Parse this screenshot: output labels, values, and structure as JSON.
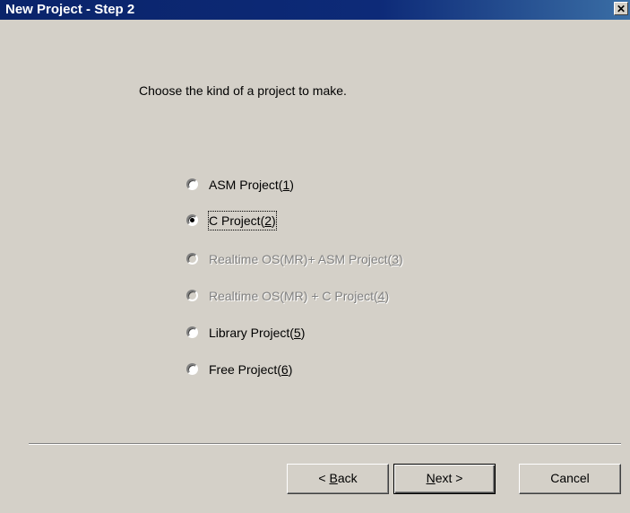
{
  "window": {
    "title": "New Project - Step 2",
    "close_glyph": "✕"
  },
  "prompt": "Choose the kind of a project to make.",
  "options": [
    {
      "pre": "ASM Project(",
      "key": "1",
      "post": ")",
      "checked": false,
      "enabled": true
    },
    {
      "pre": "C Project(",
      "key": "2",
      "post": ")",
      "checked": true,
      "enabled": true
    },
    {
      "pre": "Realtime OS(MR)+ ASM Project(",
      "key": "3",
      "post": ")",
      "checked": false,
      "enabled": false
    },
    {
      "pre": "Realtime OS(MR) + C Project(",
      "key": "4",
      "post": ")",
      "checked": false,
      "enabled": false
    },
    {
      "pre": "Library Project(",
      "key": "5",
      "post": ")",
      "checked": false,
      "enabled": true
    },
    {
      "pre": "Free Project(",
      "key": "6",
      "post": ")",
      "checked": false,
      "enabled": true
    }
  ],
  "buttons": {
    "back": {
      "pre": "< ",
      "key": "B",
      "post": "ack"
    },
    "next": {
      "pre": "",
      "key": "N",
      "post": "ext >"
    },
    "cancel": {
      "label": "Cancel"
    }
  }
}
